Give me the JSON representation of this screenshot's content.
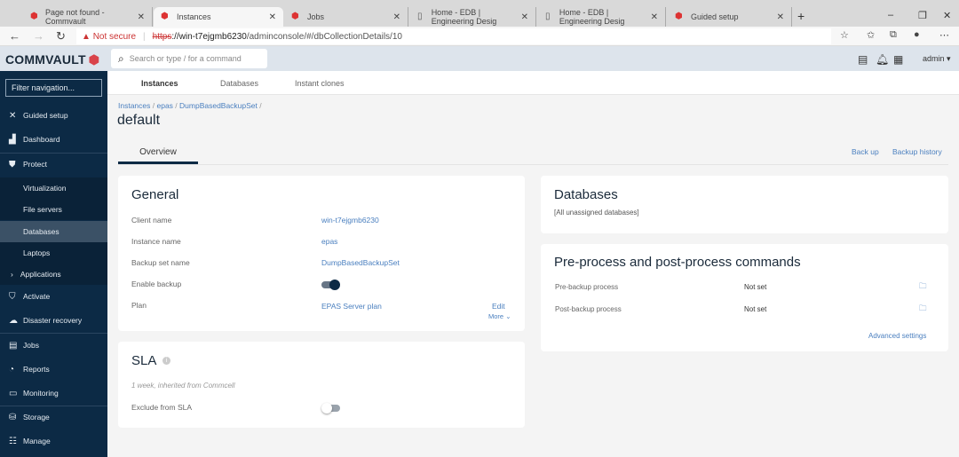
{
  "browser": {
    "tabs": [
      {
        "label": "Page not found - Commvault"
      },
      {
        "label": "Instances",
        "active": true
      },
      {
        "label": "Jobs"
      },
      {
        "label": "Home - EDB | Engineering Desig"
      },
      {
        "label": "Home - EDB | Engineering Desig"
      },
      {
        "label": "Guided setup"
      }
    ],
    "security": "Not secure",
    "url_scheme": "https",
    "url_host": "://win-t7ejgmb6230",
    "url_path": "/adminconsole/#/dbCollectionDetails/10"
  },
  "header": {
    "logo": "COMMVAULT",
    "search_placeholder": "Search or type / for a command",
    "user": "admin"
  },
  "sidebar": {
    "filter_placeholder": "Filter navigation...",
    "items": [
      {
        "label": "Guided setup",
        "icon": "tools-icon"
      },
      {
        "label": "Dashboard",
        "icon": "dashboard-icon"
      },
      {
        "label": "Protect",
        "icon": "shield-icon"
      },
      {
        "label": "Virtualization",
        "sub": true
      },
      {
        "label": "File servers",
        "sub": true
      },
      {
        "label": "Databases",
        "sub": true,
        "selected": true
      },
      {
        "label": "Laptops",
        "sub": true
      },
      {
        "label": "Applications",
        "sub": true
      },
      {
        "label": "Activate",
        "icon": "activate-icon"
      },
      {
        "label": "Disaster recovery",
        "icon": "cloud-icon"
      },
      {
        "label": "Jobs",
        "icon": "jobs-icon"
      },
      {
        "label": "Reports",
        "icon": "reports-icon"
      },
      {
        "label": "Monitoring",
        "icon": "monitor-icon"
      },
      {
        "label": "Storage",
        "icon": "storage-icon"
      },
      {
        "label": "Manage",
        "icon": "manage-icon"
      }
    ]
  },
  "subnav": [
    "Instances",
    "Databases",
    "Instant clones"
  ],
  "breadcrumb": [
    "Instances",
    "epas",
    "DumpBasedBackupSet"
  ],
  "page_title": "default",
  "tab": "Overview",
  "actions": {
    "backup": "Back up",
    "history": "Backup history"
  },
  "general": {
    "title": "General",
    "client_label": "Client name",
    "client": "win-t7ejgmb6230",
    "instance_label": "Instance name",
    "instance": "epas",
    "backupset_label": "Backup set name",
    "backupset": "DumpBasedBackupSet",
    "enable_label": "Enable backup",
    "enable": true,
    "plan_label": "Plan",
    "plan": "EPAS Server plan",
    "edit": "Edit",
    "more": "More"
  },
  "sla": {
    "title": "SLA",
    "note": "1 week, inherited from Commcell",
    "exclude_label": "Exclude from SLA",
    "exclude": false
  },
  "databases": {
    "title": "Databases",
    "value": "[All unassigned databases]"
  },
  "process": {
    "title": "Pre-process and post-process commands",
    "pre_label": "Pre-backup process",
    "pre": "Not set",
    "post_label": "Post-backup process",
    "post": "Not set",
    "advanced": "Advanced settings"
  },
  "colors": {
    "sidebar": "#0c2a45",
    "accent": "#4a7fbf",
    "brand": "#d9434a"
  }
}
